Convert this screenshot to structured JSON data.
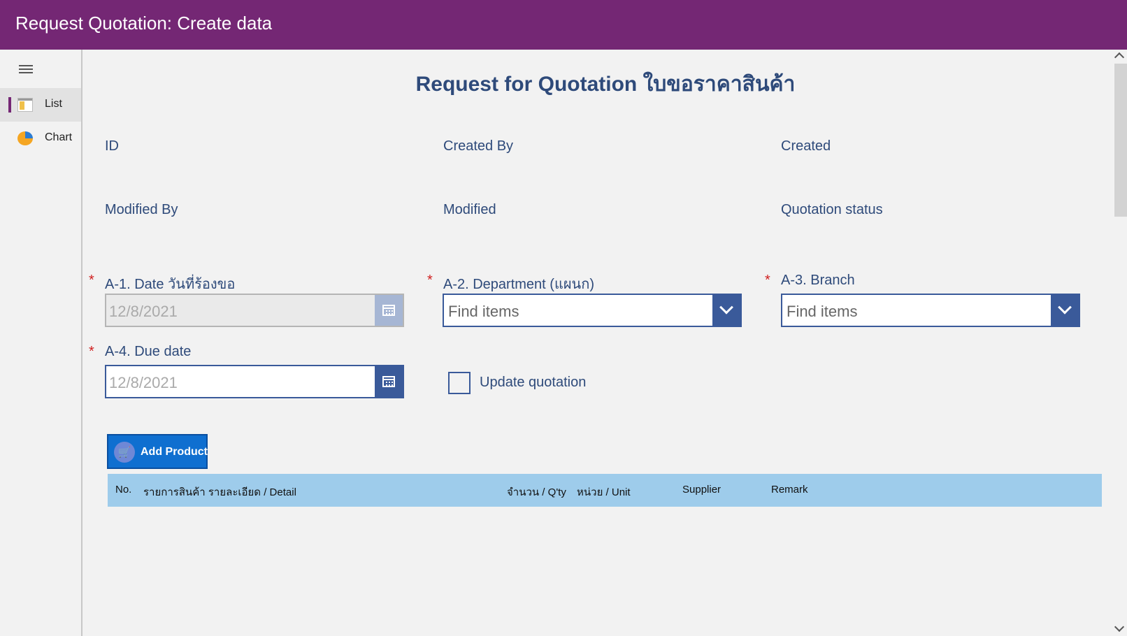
{
  "header": {
    "title": "Request Quotation: Create data"
  },
  "sidebar": {
    "items": [
      {
        "label": "List",
        "icon": "list-icon"
      },
      {
        "label": "Chart",
        "icon": "chart-icon"
      }
    ]
  },
  "form": {
    "title": "Request for Quotation ใบขอราคาสินค้า",
    "info_labels": {
      "id": "ID",
      "created_by": "Created By",
      "created": "Created",
      "modified_by": "Modified By",
      "modified": "Modified",
      "quotation_status": "Quotation status"
    },
    "fields": {
      "date": {
        "label": "A-1. Date วันที่ร้องขอ",
        "value": "12/8/2021"
      },
      "department": {
        "label": "A-2. Department (แผนก)",
        "placeholder": "Find items"
      },
      "branch": {
        "label": "A-3. Branch",
        "placeholder": "Find items"
      },
      "due_date": {
        "label": "A-4. Due date",
        "value": "12/8/2021"
      },
      "update_quotation": {
        "label": "Update quotation",
        "checked": false
      }
    },
    "required_marker": "*",
    "add_product_label": "Add Product",
    "grid_columns": [
      "No.",
      "รายการสินค้า รายละเอียด / Detail",
      "จำนวน / Q'ty",
      "หน่วย / Unit",
      "Supplier",
      "Remark"
    ]
  },
  "colors": {
    "header_bg": "#742774",
    "accent": "#3a5a9a",
    "title_text": "#2e4a7a",
    "grid_header_bg": "#9ecceb",
    "button_bg": "#0f6fd0"
  }
}
